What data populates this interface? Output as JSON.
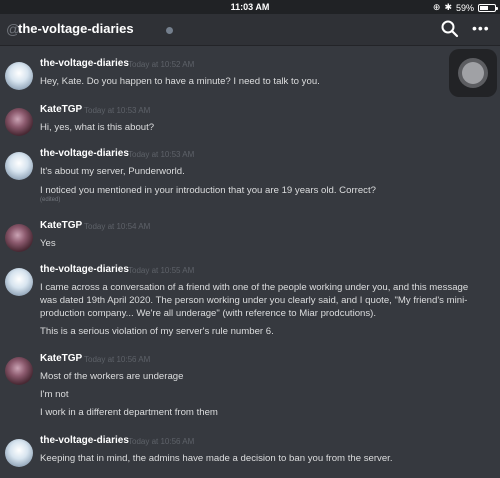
{
  "statusbar": {
    "time": "11:03 AM",
    "battery": "59%",
    "battery_level": 0.59
  },
  "header": {
    "prefix": "@",
    "channel": "the-voltage-diaries",
    "search_icon": "search-icon",
    "more_icon": "more-icon"
  },
  "messages": [
    {
      "author": "the-voltage-diaries",
      "timestamp": "Today at 10:52 AM",
      "lines": [
        "Hey, Kate. Do you happen to have a minute? I need to talk to you."
      ]
    },
    {
      "author": "KateTGP",
      "timestamp": "Today at 10:53 AM",
      "lines": [
        "Hi, yes, what is this about?"
      ]
    },
    {
      "author": "the-voltage-diaries",
      "timestamp": "Today at 10:53 AM",
      "lines": [
        "It's about my server, Punderworld.",
        "I noticed you mentioned in your introduction that you are 19 years old. Correct?"
      ],
      "edited": "(edited)"
    },
    {
      "author": "KateTGP",
      "timestamp": "Today at 10:54 AM",
      "lines": [
        "Yes"
      ]
    },
    {
      "author": "the-voltage-diaries",
      "timestamp": "Today at 10:55 AM",
      "lines": [
        "I came across a conversation of a friend with one of the people working under you, and this message",
        "was dated 19th April 2020. The person working under you clearly said, and I quote, \"My friend's mini-",
        "production company... We're all underage\" (with reference to Miar prodcutions).",
        "This is a serious violation of my server's rule number 6."
      ]
    },
    {
      "author": "KateTGP",
      "timestamp": "Today at 10:56 AM",
      "lines": [
        "Most of the workers are underage",
        "I'm not",
        "I work in a different department from them"
      ]
    },
    {
      "author": "the-voltage-diaries",
      "timestamp": "Today at 10:56 AM",
      "lines": [
        "Keeping that in mind, the admins have made a decision to ban you from the server."
      ]
    }
  ]
}
